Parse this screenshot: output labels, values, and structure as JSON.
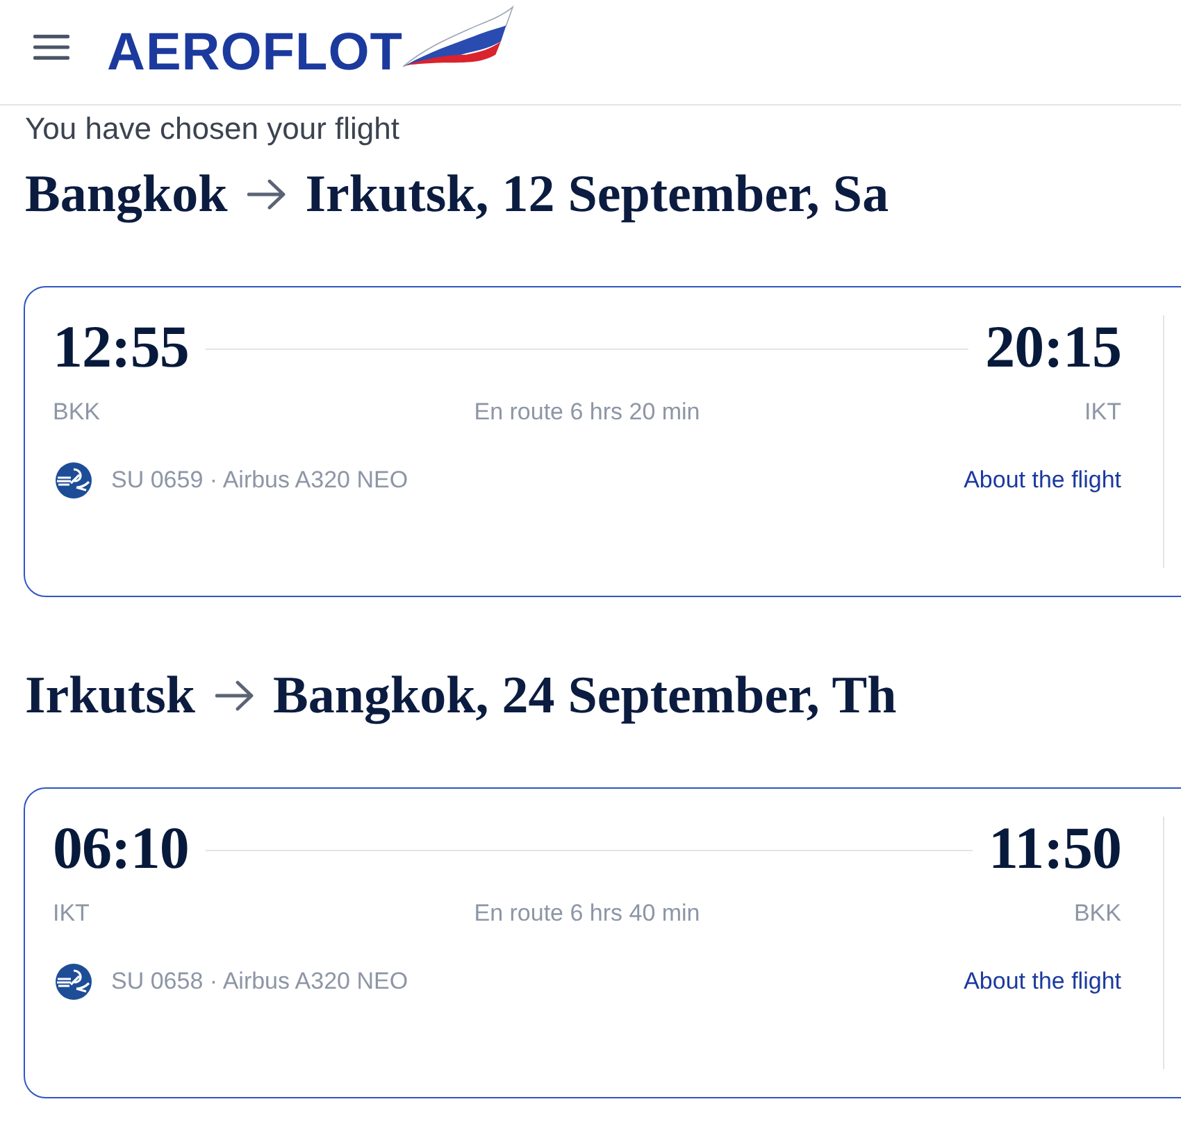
{
  "header": {
    "logo_text": "AEROFLOT"
  },
  "intro": "You have chosen your flight",
  "segments": [
    {
      "from": "Bangkok",
      "to": "Irkutsk, 12 September, Sa",
      "departure_time": "12:55",
      "departure_airport": "BKK",
      "duration": "En route 6 hrs 20 min",
      "arrival_time": "20:15",
      "arrival_airport": "IKT",
      "flight": "SU 0659 · Airbus A320 NEO",
      "details_link": "About the flight"
    },
    {
      "from": "Irkutsk",
      "to": "Bangkok, 24 September, Th",
      "departure_time": "06:10",
      "departure_airport": "IKT",
      "duration": "En route 6 hrs 40 min",
      "arrival_time": "11:50",
      "arrival_airport": "BKK",
      "flight": "SU 0658 · Airbus A320 NEO",
      "details_link": "About the flight"
    }
  ]
}
